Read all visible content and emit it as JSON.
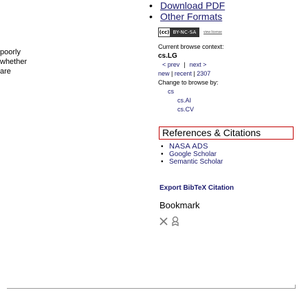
{
  "left_fragments": [
    "poorly",
    "whether",
    "are"
  ],
  "downloads": {
    "items": [
      "Download PDF",
      "Other Formats"
    ]
  },
  "license": {
    "badge_cc": "(cc)",
    "badge_text": "BY-NC-SA",
    "link": "view license"
  },
  "browse": {
    "context_label": "Current browse context:",
    "context": "cs.LG",
    "prev": "< prev",
    "next": "next >",
    "new": "new",
    "recent": "recent",
    "year": "2307",
    "change_label": "Change to browse by:",
    "parent": "cs",
    "children": [
      "cs.AI",
      "cs.CV"
    ]
  },
  "references": {
    "title": "References & Citations",
    "items": [
      "NASA ADS",
      "Google Scholar",
      "Semantic Scholar"
    ]
  },
  "export": "Export BibTeX Citation",
  "bookmark": {
    "title": "Bookmark",
    "icons": [
      "x-icon",
      "bookmark-icon"
    ]
  },
  "colors": {
    "link": "#1a1a6e",
    "highlight_border": "#c10000"
  }
}
